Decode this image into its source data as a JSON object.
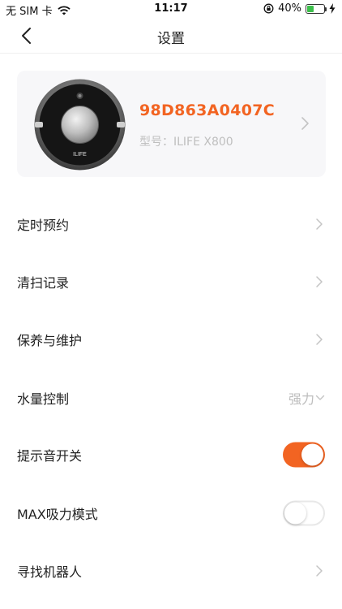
{
  "status_bar": {
    "carrier": "无 SIM 卡",
    "time": "11:17",
    "battery_percent": "40%",
    "battery_level": 0.4,
    "battery_color": "#3cc04b",
    "icons": [
      "wifi-icon",
      "orientation-lock-icon",
      "battery-icon",
      "charging-icon"
    ]
  },
  "nav": {
    "title": "设置",
    "back_icon": "chevron-left-icon"
  },
  "device": {
    "id": "98D863A0407C",
    "model": "型号：ILIFE X800",
    "brand_on_image": "ILIFE",
    "accent_color": "#f26422"
  },
  "settings": [
    {
      "label": "定时预约",
      "type": "link"
    },
    {
      "label": "清扫记录",
      "type": "link"
    },
    {
      "label": "保养与维护",
      "type": "link"
    },
    {
      "label": "水量控制",
      "type": "select",
      "value": "强力"
    },
    {
      "label": "提示音开关",
      "type": "toggle",
      "on": true
    },
    {
      "label": "MAX吸力模式",
      "type": "toggle",
      "on": false
    },
    {
      "label": "寻找机器人",
      "type": "link"
    }
  ]
}
